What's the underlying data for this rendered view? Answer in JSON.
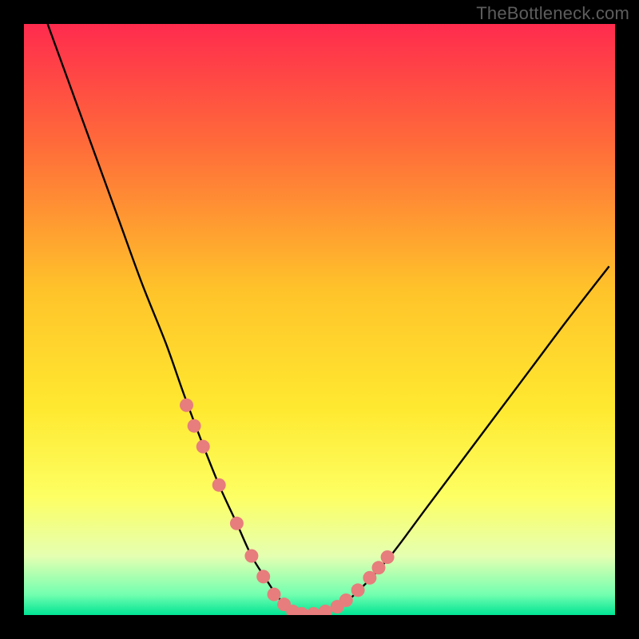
{
  "watermark": "TheBottleneck.com",
  "colors": {
    "frame": "#000000",
    "curve": "#000000",
    "dot_fill": "#e77d7c",
    "gradient_stops": [
      {
        "pos": 0.0,
        "color": "#ff2b4e"
      },
      {
        "pos": 0.2,
        "color": "#ff6a3a"
      },
      {
        "pos": 0.45,
        "color": "#ffc32a"
      },
      {
        "pos": 0.65,
        "color": "#ffe930"
      },
      {
        "pos": 0.8,
        "color": "#fdff63"
      },
      {
        "pos": 0.9,
        "color": "#e5ffb1"
      },
      {
        "pos": 0.965,
        "color": "#74ffb0"
      },
      {
        "pos": 1.0,
        "color": "#00e594"
      }
    ]
  },
  "chart_data": {
    "type": "line",
    "title": "",
    "xlabel": "",
    "ylabel": "",
    "xlim": [
      0,
      100
    ],
    "ylim": [
      0,
      100
    ],
    "series": [
      {
        "name": "bottleneck-curve",
        "x": [
          4,
          8,
          12,
          16,
          20,
          24,
          27,
          30,
          33,
          36,
          38.5,
          41,
          43,
          45,
          47,
          49,
          53,
          57,
          62,
          68,
          74,
          80,
          86,
          92,
          99
        ],
        "y": [
          100,
          89,
          78,
          67,
          56,
          46,
          37.5,
          29.5,
          22,
          15.5,
          10,
          6,
          3,
          1.2,
          0.2,
          0.2,
          1.2,
          4.5,
          10,
          18,
          26,
          34,
          42,
          50,
          59
        ]
      }
    ],
    "dots": {
      "name": "highlight-dots",
      "x": [
        27.5,
        28.8,
        30.3,
        33.0,
        36.0,
        38.5,
        40.5,
        42.3,
        44.0,
        45.5,
        47.0,
        49.0,
        51.0,
        53.0,
        54.5,
        56.5,
        58.5,
        60.0,
        61.5
      ],
      "y": [
        35.5,
        32.0,
        28.5,
        22.0,
        15.5,
        10.0,
        6.5,
        3.5,
        1.8,
        0.6,
        0.2,
        0.2,
        0.6,
        1.4,
        2.5,
        4.2,
        6.3,
        8.0,
        9.8
      ]
    }
  }
}
